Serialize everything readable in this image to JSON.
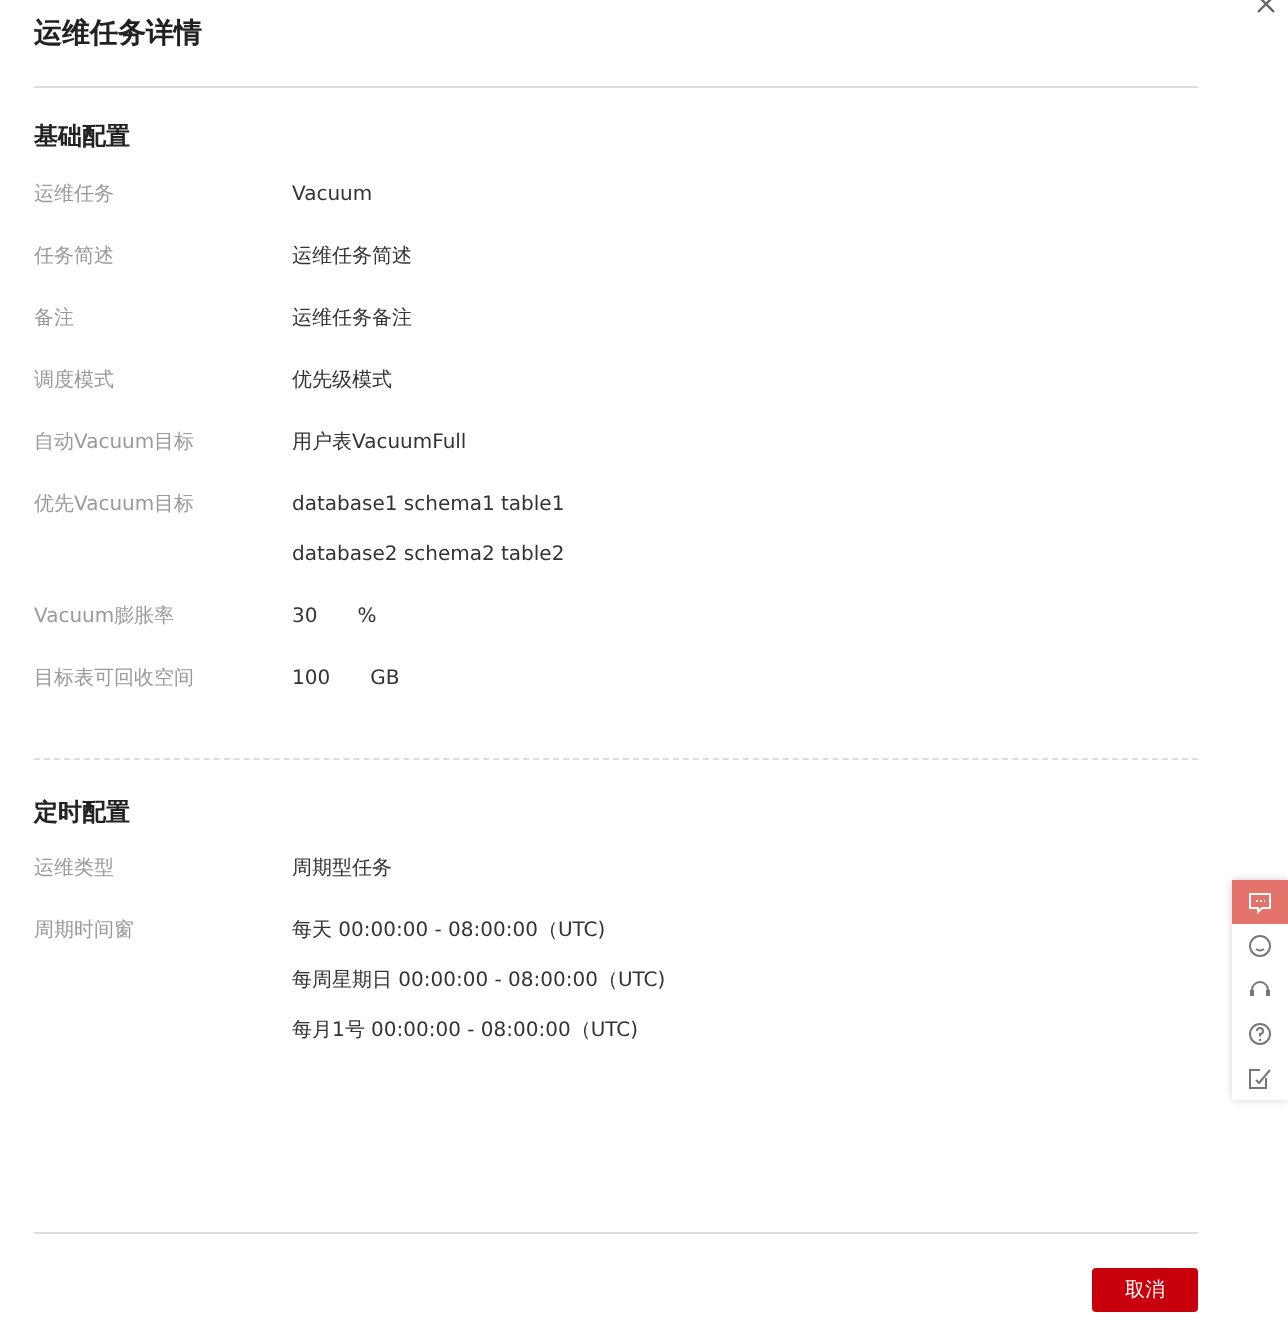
{
  "dialog": {
    "title": "运维任务详情"
  },
  "sections": [
    {
      "title": "基础配置",
      "rows": [
        {
          "label": "运维任务",
          "values": [
            {
              "text": "Vacuum"
            }
          ]
        },
        {
          "label": "任务简述",
          "values": [
            {
              "text": "运维任务简述"
            }
          ]
        },
        {
          "label": "备注",
          "values": [
            {
              "text": "运维任务备注"
            }
          ]
        },
        {
          "label": "调度模式",
          "values": [
            {
              "text": "优先级模式"
            }
          ]
        },
        {
          "label": "自动Vacuum目标",
          "values": [
            {
              "text": "用户表VacuumFull"
            }
          ]
        },
        {
          "label": "优先Vacuum目标",
          "values": [
            {
              "text": "database1 schema1 table1"
            },
            {
              "text": "database2 schema2 table2"
            }
          ]
        },
        {
          "label": "Vacuum膨胀率",
          "values": [
            {
              "text": "30",
              "unit": "%"
            }
          ]
        },
        {
          "label": "目标表可回收空间",
          "values": [
            {
              "text": "100",
              "unit": "GB"
            }
          ]
        }
      ]
    },
    {
      "title": "定时配置",
      "rows": [
        {
          "label": "运维类型",
          "values": [
            {
              "text": "周期型任务"
            }
          ]
        },
        {
          "label": "周期时间窗",
          "values": [
            {
              "text": "每天 00:00:00 - 08:00:00（UTC)"
            },
            {
              "text": "每周星期日 00:00:00 - 08:00:00（UTC)"
            },
            {
              "text": "每月1号 00:00:00 - 08:00:00（UTC)"
            }
          ]
        }
      ]
    }
  ],
  "side_tools": [
    {
      "kind": "chat",
      "selected": true
    },
    {
      "kind": "smile",
      "selected": false
    },
    {
      "kind": "headset",
      "selected": false
    },
    {
      "kind": "help",
      "selected": false
    },
    {
      "kind": "edit",
      "selected": false
    }
  ],
  "buttons": [
    {
      "label": "取消"
    }
  ]
}
